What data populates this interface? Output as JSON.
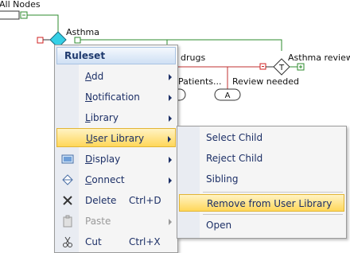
{
  "diagram": {
    "all_nodes_label": "All Nodes",
    "asthma_label": "Asthma",
    "drugs_label": "drugs",
    "asthma_review_label": "Asthma review",
    "patients_label": "Patients...",
    "review_needed_label": "Review needed",
    "node_t_label": "T",
    "node_a_label": "A",
    "line_color": "#2e8b2e"
  },
  "menu": {
    "header": "Ruleset",
    "items": [
      {
        "label": "Add",
        "underline": "A",
        "rest": "dd",
        "has_submenu": true
      },
      {
        "label": "Notification",
        "underline": "N",
        "rest": "otification",
        "has_submenu": true
      },
      {
        "label": "Library",
        "underline": "L",
        "rest": "ibrary",
        "has_submenu": true
      },
      {
        "label": "User Library",
        "underline": "U",
        "rest": "ser Library",
        "has_submenu": true,
        "highlighted": true
      },
      {
        "label": "Display",
        "underline": "D",
        "rest": "isplay",
        "has_submenu": true,
        "icon": "display-icon"
      },
      {
        "label": "Connect",
        "underline": "C",
        "rest": "onnect",
        "has_submenu": true,
        "icon": "connect-icon"
      },
      {
        "label": "Delete",
        "shortcut": "Ctrl+D",
        "icon": "delete-icon"
      },
      {
        "label": "Paste",
        "has_submenu": true,
        "disabled": true,
        "icon": "paste-icon"
      },
      {
        "label": "Cut",
        "shortcut": "Ctrl+X",
        "icon": "cut-icon"
      }
    ]
  },
  "submenu": {
    "items": [
      {
        "label": "Select Child"
      },
      {
        "label": "Reject Child"
      },
      {
        "label": "Sibling"
      },
      {
        "label": "Remove from User Library",
        "highlighted": true
      },
      {
        "label": "Open"
      }
    ]
  }
}
